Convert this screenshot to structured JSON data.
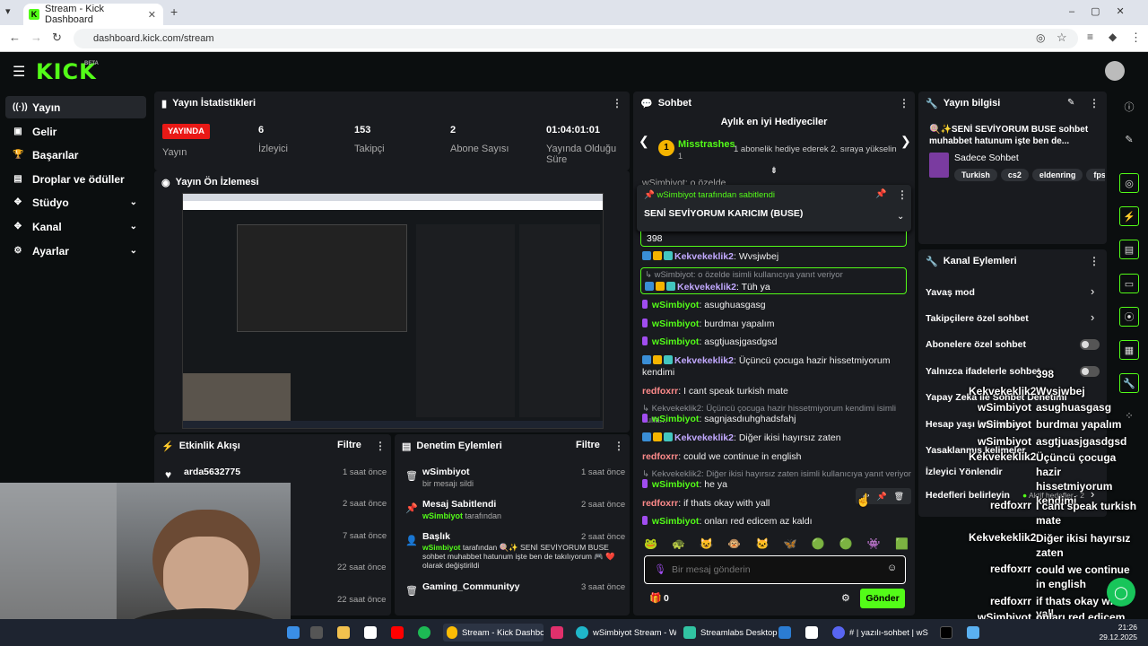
{
  "browser": {
    "tab_title": "Stream - Kick Dashboard",
    "new_tab": "+",
    "url": "dashboard.kick.com/stream"
  },
  "header": {
    "logo": "KICK",
    "beta": "BETA"
  },
  "sidebar": {
    "items": [
      {
        "label": "Yayın",
        "icon": "radio-icon"
      },
      {
        "label": "Gelir",
        "icon": "money-icon"
      },
      {
        "label": "Başarılar",
        "icon": "trophy-icon"
      },
      {
        "label": "Droplar ve ödüller",
        "icon": "gift-icon"
      },
      {
        "label": "Stüdyo",
        "icon": "studio-icon"
      },
      {
        "label": "Kanal",
        "icon": "channel-icon"
      },
      {
        "label": "Ayarlar",
        "icon": "gear-icon"
      }
    ]
  },
  "stats": {
    "title": "Yayın İstatistikleri",
    "live_badge": "YAYINDA",
    "live_label": "Yayın",
    "viewers_value": "6",
    "viewers_label": "İzleyici",
    "followers_value": "153",
    "followers_label": "Takipçi",
    "subs_value": "2",
    "subs_label": "Abone Sayısı",
    "duration_value": "01:04:01:01",
    "duration_label": "Yayında Olduğu Süre"
  },
  "preview": {
    "title": "Yayın Ön İzlemesi"
  },
  "activity": {
    "title": "Etkinlik Akışı",
    "filter": "Filtre",
    "items": [
      {
        "name": "arda5632775",
        "time": "1 saat önce"
      },
      {
        "name": "",
        "time": "2 saat önce"
      },
      {
        "name": "",
        "time": "7 saat önce"
      },
      {
        "name": "",
        "time": "22 saat önce"
      },
      {
        "name": "",
        "time": "22 saat önce"
      }
    ]
  },
  "mod": {
    "title": "Denetim Eylemleri",
    "filter": "Filtre",
    "items": [
      {
        "title": "wSimbiyot",
        "sub": "bir mesajı sildi",
        "time": "1 saat önce"
      },
      {
        "title": "Mesaj Sabitlendi",
        "sub_user": "wSimbiyot",
        "sub": "tarafından",
        "time": "2 saat önce"
      },
      {
        "title": "Başlık",
        "sub_user": "wSimbiyot",
        "sub": "tarafından 🍭✨ SENİ SEVİYORUM BUSE sohbet muhabbet hatunum işte ben de takılıyorum 🎮 ❤️ olarak değiştirildi",
        "time": "2 saat önce"
      },
      {
        "title": "Gaming_Communityy",
        "sub": "",
        "time": "3 saat önce"
      }
    ]
  },
  "chat": {
    "title": "Sohbet",
    "gifters_title": "Aylık en iyi Hediyeciler",
    "gifter_rank": "1",
    "gifter_name": "Misstrashes",
    "gifter_count": "1",
    "gifter_hint": "1 abonelik hediye ederek 2. sıraya yükselin",
    "top_partial": "wSimbiyot: o özelde",
    "pinned_by": "wSimbiyot tarafından sabitlendi",
    "pinned_text": "SENİ SEVİYORUM KARICIM (BUSE)",
    "partial_398": "398",
    "input_placeholder": "Bir mesaj gönderin",
    "points": "0",
    "send": "Gönder",
    "emotes": [
      "🐸",
      "🐢",
      "😺",
      "🐵",
      "🐱",
      "🦋",
      "🟢",
      "🟢",
      "👾",
      "🟩"
    ]
  },
  "info": {
    "title": "Yayın bilgisi",
    "stream_title": "🍭✨SENİ SEVİYORUM BUSE sohbet muhabbet hatunum işte ben de...",
    "category": "Sadece Sohbet",
    "tags": [
      "Turkish",
      "cs2",
      "eldenring",
      "fps"
    ]
  },
  "actions": {
    "title": "Kanal Eylemleri",
    "slow": "Yavaş mod",
    "followers_only": "Takipçilere özel sohbet",
    "subs_only": "Abonelere özel sohbet",
    "emote_only": "Yalnızca ifadelerle sohbet",
    "ai_mod": "Yapay Zeka ile Sohbet Denetimi",
    "account_age": "Hesap yaşı kısıtlaması",
    "banned_words": "Yasaklanmış kelimeler",
    "viewer_redirect": "İzleyici Yönlendir",
    "goals": "Hedefleri belirleyin",
    "goals_status": "Aktif hedefler - 2"
  },
  "overlay_chat": {
    "lines": [
      {
        "user": "",
        "text": "398"
      },
      {
        "user": "Kekvekeklik2",
        "text": "Wvsjwbej"
      },
      {
        "user": "wSimbiyot",
        "text": "asughuasgasg"
      },
      {
        "user": "wSimbiyot",
        "text": "burdmaı yapalım"
      },
      {
        "user": "wSimbiyot",
        "text": "asgtjuasjgasdgsd"
      },
      {
        "user": "Kekvekeklik2",
        "text": "Üçüncü çocuga hazir hissetmiyorum kendimi"
      },
      {
        "user": "redfoxrr",
        "text": "I cant speak turkish mate"
      },
      {
        "user": "Kekvekeklik2",
        "text": "Diğer ikisi hayırsız zaten"
      },
      {
        "user": "redfoxrr",
        "text": "could we continue in english"
      },
      {
        "user": "redfoxrr",
        "text": "if thats okay with yall"
      },
      {
        "user": "wSimbiyot",
        "text": "onları red edicem az kaldı"
      }
    ]
  },
  "taskbar": {
    "chrome_label": "Stream - Kick Dashboard",
    "edge_label": "wSimbiyot Stream - Wa",
    "streamlabs_label": "Streamlabs Desktop",
    "discord_label": "# | yazılı-sohbet | wS",
    "time": "21:26",
    "date": "29.12.2025"
  },
  "colors": {
    "kick_green": "#53fc18",
    "live_red": "#e91916",
    "panel": "#191b1f"
  }
}
